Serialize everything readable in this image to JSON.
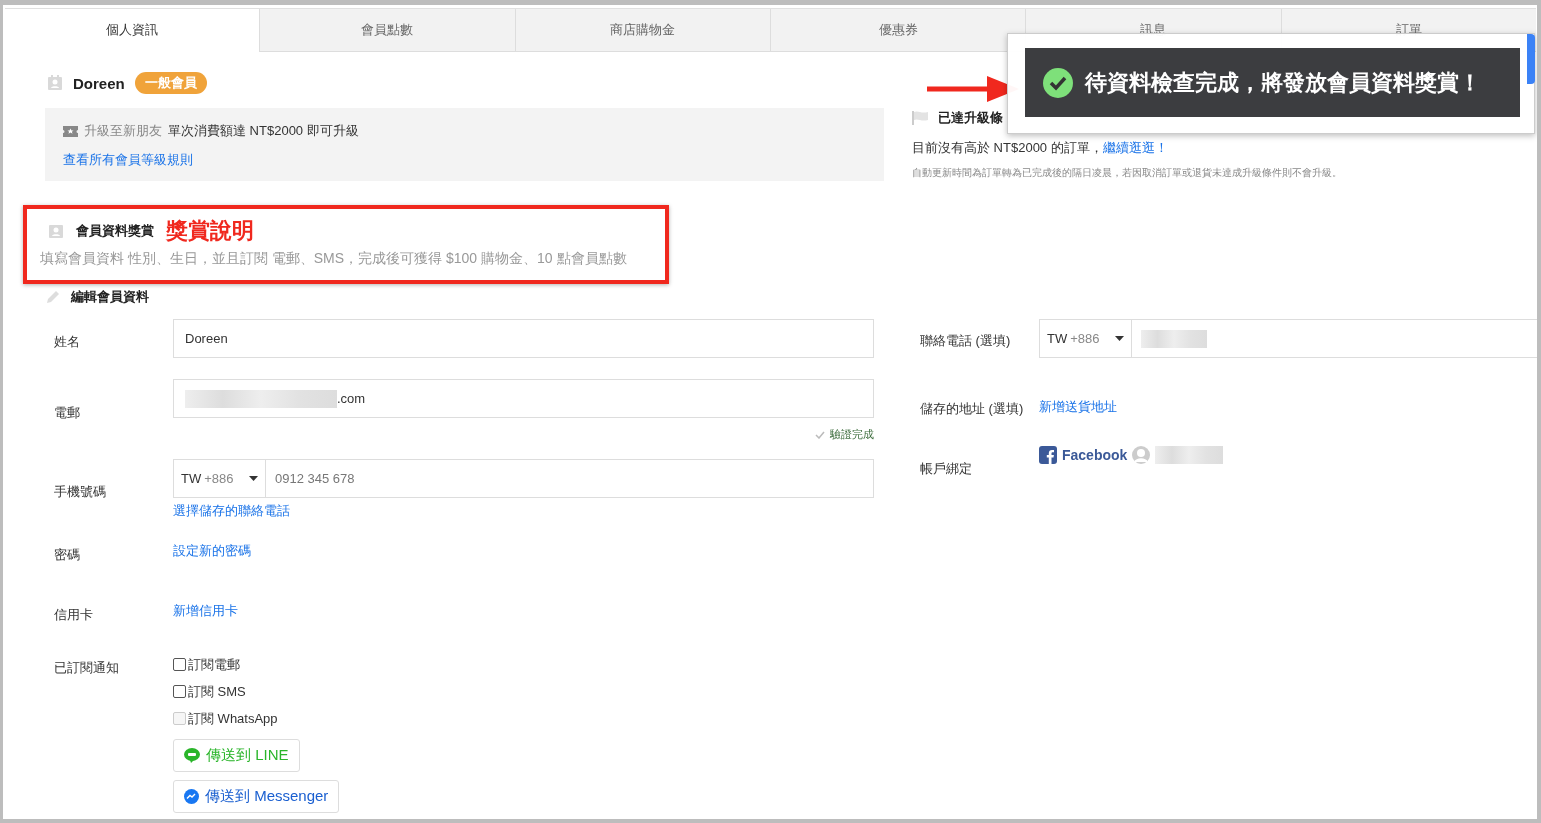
{
  "tabs": [
    {
      "label": "個人資訊",
      "selected": true
    },
    {
      "label": "會員點數",
      "selected": false
    },
    {
      "label": "商店購物金",
      "selected": false
    },
    {
      "label": "優惠券",
      "selected": false
    },
    {
      "label": "訊息",
      "selected": false
    },
    {
      "label": "訂單",
      "selected": false
    }
  ],
  "member": {
    "name": "Doreen",
    "tier": "一般會員"
  },
  "upgrade_box": {
    "label": "升級至新朋友",
    "condition": "單次消費額達 NT$2000 即可升級",
    "link": "查看所有會員等級規則"
  },
  "reward": {
    "title": "會員資料獎賞",
    "annotation": "獎賞說明",
    "description": "填寫會員資料 性別、生日，並且訂閱 電郵、SMS，完成後可獲得 $100 購物金、10 點會員點數"
  },
  "upgrade_status": {
    "title": "已達升級條",
    "message": "目前沒有高於 NT$2000 的訂單，",
    "link": "繼續逛逛！",
    "note": "自動更新時間為訂單轉為已完成後的隔日凌晨，若因取消訂單或退貨未達成升級條件則不會升級。"
  },
  "edit_title": "編輯會員資料",
  "left_fields": [
    {
      "kind": "input",
      "label": "姓名",
      "value": "Doreen"
    },
    {
      "kind": "email",
      "label": "電郵",
      "value": ".com",
      "verified": "驗證完成"
    },
    {
      "kind": "phone",
      "label": "手機號碼",
      "country": "TW",
      "code": "+886",
      "placeholder": "0912 345 678",
      "link": "選擇儲存的聯絡電話"
    },
    {
      "kind": "link",
      "label": "密碼",
      "link": "設定新的密碼"
    },
    {
      "kind": "link",
      "label": "信用卡",
      "link": "新增信用卡"
    },
    {
      "kind": "subscriptions",
      "label": "已訂閱通知",
      "options": [
        {
          "label": "訂閱電郵",
          "checked": false,
          "disabled": false
        },
        {
          "label": "訂閱 SMS",
          "checked": false,
          "disabled": false
        },
        {
          "label": "訂閱 WhatsApp",
          "checked": false,
          "disabled": true
        }
      ],
      "buttons": [
        {
          "kind": "line",
          "label": "傳送到 LINE"
        },
        {
          "kind": "messenger",
          "label": "傳送到 Messenger"
        }
      ]
    }
  ],
  "right_fields": [
    {
      "kind": "phone",
      "label": "聯絡電話 (選填)",
      "country": "TW",
      "code": "+886"
    },
    {
      "kind": "link",
      "label": "儲存的地址 (選填)",
      "link": "新增送貨地址"
    },
    {
      "kind": "social",
      "label": "帳戶綁定",
      "provider": "Facebook"
    }
  ],
  "toast": {
    "message": "待資料檢查完成，將發放會員資料獎賞！"
  }
}
